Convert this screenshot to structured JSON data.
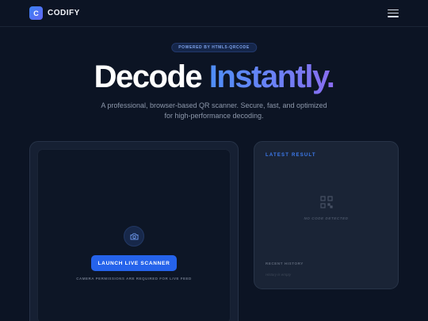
{
  "header": {
    "logo_letter": "C",
    "brand_name": "CODIFY",
    "menu_icon": "hamburger-menu-icon"
  },
  "hero": {
    "badge": "POWERED BY HTML5-QRCODE",
    "title_part1": "Decode",
    "title_part2": "Instantly.",
    "subtitle_line1": "A professional, browser-based QR scanner. Secure, fast, and optimized",
    "subtitle_line2": "for high-performance decoding."
  },
  "scanner": {
    "camera_icon": "camera-icon",
    "launch_label": "LAUNCH LIVE SCANNER",
    "permission_note": "CAMERA PERMISSIONS ARE REQUIRED FOR LIVE FEED"
  },
  "result": {
    "title": "LATEST RESULT",
    "placeholder_icon": "qr-code-icon",
    "empty_state": "NO CODE DETECTED",
    "history_title": "RECENT HISTORY",
    "history_empty": "History is empty"
  },
  "colors": {
    "background": "#0c1424",
    "accent": "#2563eb",
    "gradient_start": "#4f8ef7",
    "gradient_end": "#8a6cf0"
  }
}
